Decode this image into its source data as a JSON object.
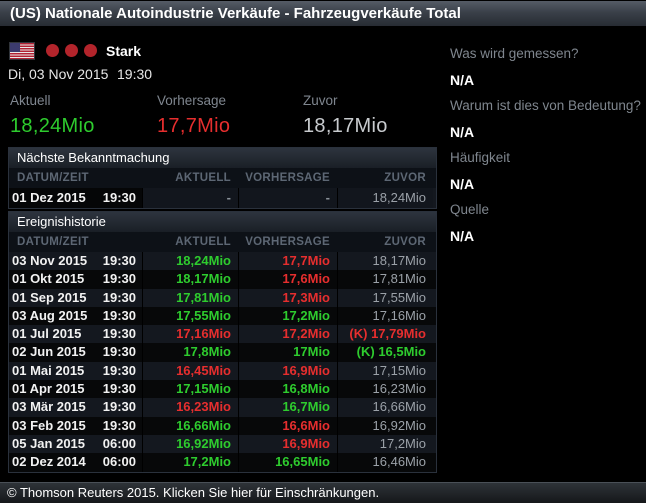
{
  "title": "(US) Nationale Autoindustrie Verkäufe - Fahrzeugverkäufe Total",
  "header": {
    "flag": "us-flag",
    "importance_dots": 3,
    "importance_label": "Stark",
    "date": "Di, 03 Nov 2015",
    "time": "19:30"
  },
  "summary": {
    "columns": [
      {
        "label": "Aktuell",
        "value": "18,24Mio",
        "color": "green"
      },
      {
        "label": "Vorhersage",
        "value": "17,7Mio",
        "color": "red"
      },
      {
        "label": "Zuvor",
        "value": "18,17Mio",
        "color": "gray"
      }
    ]
  },
  "sidebar": {
    "items": [
      {
        "question": "Was wird gemessen?",
        "answer": "N/A"
      },
      {
        "question": "Warum ist dies von Bedeutung?",
        "answer": "N/A"
      },
      {
        "question": "Häufigkeit",
        "answer": "N/A"
      },
      {
        "question": "Quelle",
        "answer": "N/A"
      }
    ]
  },
  "next_announcement": {
    "section_title": "Nächste Bekanntmachung",
    "columns": [
      "DATUM/ZEIT",
      "AKTUELL",
      "VORHERSAGE",
      "ZUVOR"
    ],
    "rows": [
      {
        "date": "01 Dez 2015",
        "time": "19:30",
        "aktuell": [
          "-",
          "dash"
        ],
        "vorhersage": [
          "-",
          "dash"
        ],
        "zuvor": [
          "18,24Mio",
          "gray"
        ]
      }
    ]
  },
  "history": {
    "section_title": "Ereignishistorie",
    "columns": [
      "DATUM/ZEIT",
      "AKTUELL",
      "VORHERSAGE",
      "ZUVOR"
    ],
    "rows": [
      {
        "date": "03 Nov 2015",
        "time": "19:30",
        "aktuell": [
          "18,24Mio",
          "green"
        ],
        "vorhersage": [
          "17,7Mio",
          "red"
        ],
        "zuvor": [
          "18,17Mio",
          "gray"
        ]
      },
      {
        "date": "01 Okt 2015",
        "time": "19:30",
        "aktuell": [
          "18,17Mio",
          "green"
        ],
        "vorhersage": [
          "17,6Mio",
          "red"
        ],
        "zuvor": [
          "17,81Mio",
          "gray"
        ]
      },
      {
        "date": "01 Sep 2015",
        "time": "19:30",
        "aktuell": [
          "17,81Mio",
          "green"
        ],
        "vorhersage": [
          "17,3Mio",
          "red"
        ],
        "zuvor": [
          "17,55Mio",
          "gray"
        ]
      },
      {
        "date": "03 Aug 2015",
        "time": "19:30",
        "aktuell": [
          "17,55Mio",
          "green"
        ],
        "vorhersage": [
          "17,2Mio",
          "green"
        ],
        "zuvor": [
          "17,16Mio",
          "gray"
        ]
      },
      {
        "date": "01 Jul 2015",
        "time": "19:30",
        "aktuell": [
          "17,16Mio",
          "red"
        ],
        "vorhersage": [
          "17,2Mio",
          "red"
        ],
        "zuvor": [
          "(K) 17,79Mio",
          "red"
        ]
      },
      {
        "date": "02 Jun 2015",
        "time": "19:30",
        "aktuell": [
          "17,8Mio",
          "green"
        ],
        "vorhersage": [
          "17Mio",
          "green"
        ],
        "zuvor": [
          "(K) 16,5Mio",
          "green"
        ]
      },
      {
        "date": "01 Mai 2015",
        "time": "19:30",
        "aktuell": [
          "16,45Mio",
          "red"
        ],
        "vorhersage": [
          "16,9Mio",
          "red"
        ],
        "zuvor": [
          "17,15Mio",
          "gray"
        ]
      },
      {
        "date": "01 Apr 2015",
        "time": "19:30",
        "aktuell": [
          "17,15Mio",
          "green"
        ],
        "vorhersage": [
          "16,8Mio",
          "green"
        ],
        "zuvor": [
          "16,23Mio",
          "gray"
        ]
      },
      {
        "date": "03 Mär 2015",
        "time": "19:30",
        "aktuell": [
          "16,23Mio",
          "red"
        ],
        "vorhersage": [
          "16,7Mio",
          "green"
        ],
        "zuvor": [
          "16,66Mio",
          "gray"
        ]
      },
      {
        "date": "03 Feb 2015",
        "time": "19:30",
        "aktuell": [
          "16,66Mio",
          "green"
        ],
        "vorhersage": [
          "16,6Mio",
          "red"
        ],
        "zuvor": [
          "16,92Mio",
          "gray"
        ]
      },
      {
        "date": "05 Jan 2015",
        "time": "06:00",
        "aktuell": [
          "16,92Mio",
          "green"
        ],
        "vorhersage": [
          "16,9Mio",
          "red"
        ],
        "zuvor": [
          "17,2Mio",
          "gray"
        ]
      },
      {
        "date": "02 Dez 2014",
        "time": "06:00",
        "aktuell": [
          "17,2Mio",
          "green"
        ],
        "vorhersage": [
          "16,65Mio",
          "green"
        ],
        "zuvor": [
          "16,46Mio",
          "gray"
        ]
      }
    ]
  },
  "footer": {
    "text": "© Thomson Reuters 2015. Klicken Sie hier für Einschränkungen."
  },
  "colors": {
    "positive": "#2ecc2e",
    "negative": "#e62e2e",
    "neutral_value": "#9ba1a8",
    "label_gray": "#7f868e",
    "importance_dot": "#b3242b"
  }
}
